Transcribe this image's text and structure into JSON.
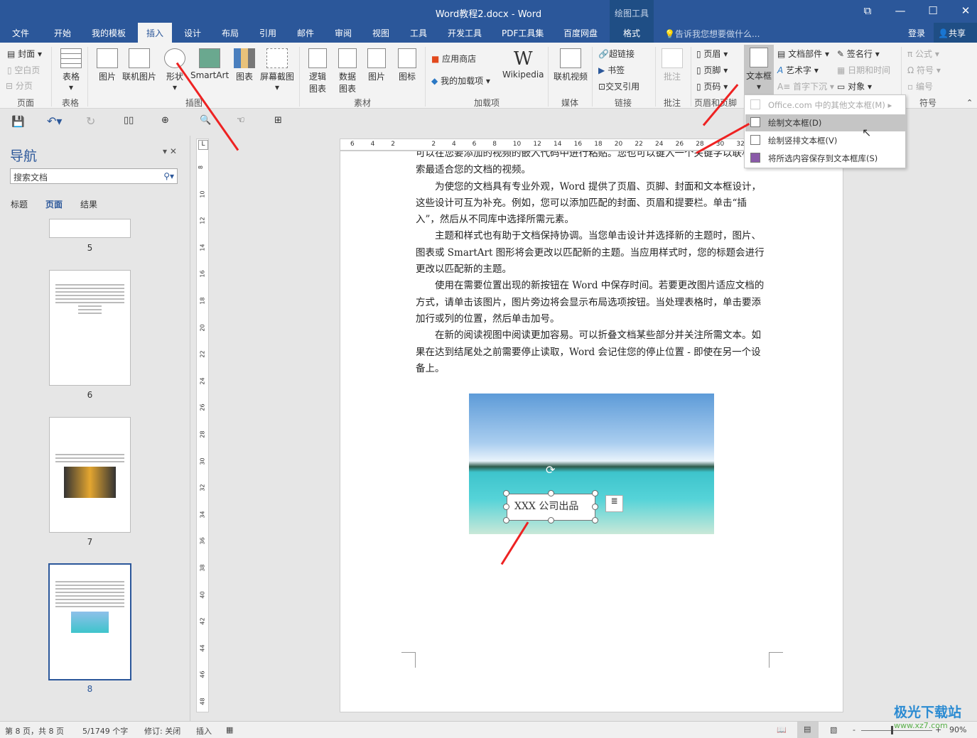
{
  "window": {
    "title": "Word教程2.docx - Word",
    "context_tab_group": "绘图工具",
    "restore_icon": "ribbon-display-icon",
    "minimize": "—",
    "maximize": "☐",
    "close": "✕"
  },
  "tabs": [
    "文件",
    "开始",
    "我的模板",
    "插入",
    "设计",
    "布局",
    "引用",
    "邮件",
    "审阅",
    "视图",
    "工具",
    "开发工具",
    "PDF工具集",
    "百度网盘",
    "格式"
  ],
  "active_tab": "插入",
  "tell_me": "告诉我您想要做什么...",
  "signin": "登录",
  "share": "共享",
  "ribbon": {
    "pages": {
      "items": [
        "封面",
        "空白页",
        "分页"
      ],
      "label": "页面"
    },
    "table": {
      "items": [
        "表格"
      ],
      "label": "表格"
    },
    "illustrations": {
      "items": [
        "图片",
        "联机图片",
        "形状",
        "SmartArt",
        "图表",
        "屏幕截图"
      ],
      "label": "插图"
    },
    "materials": {
      "items": [
        "逻辑图表",
        "数据图表",
        "图片",
        "图标"
      ],
      "label": "素材"
    },
    "addins": {
      "items": [
        "应用商店",
        "我的加载项",
        "Wikipedia"
      ],
      "label": "加载项"
    },
    "media": {
      "items": [
        "联机视频"
      ],
      "label": "媒体"
    },
    "links": {
      "items": [
        "超链接",
        "书签",
        "交叉引用"
      ],
      "label": "链接"
    },
    "comments": {
      "items": [
        "批注"
      ],
      "label": "批注"
    },
    "header_footer": {
      "items": [
        "页眉",
        "页脚",
        "页码"
      ],
      "label": "页眉和页脚"
    },
    "text": {
      "items": [
        "文本框",
        "文档部件",
        "艺术字",
        "首字下沉",
        "签名行",
        "日期和时间",
        "对象"
      ]
    },
    "symbols": {
      "items": [
        "公式",
        "符号",
        "编号"
      ],
      "label": "符号"
    }
  },
  "textbox_menu": [
    "Office.com 中的其他文本框(M)",
    "绘制文本框(D)",
    "绘制竖排文本框(V)",
    "将所选内容保存到文本框库(S)"
  ],
  "nav": {
    "title": "导航",
    "search_placeholder": "搜索文档",
    "tabs": [
      "标题",
      "页面",
      "结果"
    ],
    "active_tab": "页面",
    "pages": [
      "5",
      "6",
      "7",
      "8"
    ],
    "current_page": "8"
  },
  "ruler": {
    "h": [
      "6",
      "4",
      "2",
      "",
      "2",
      "4",
      "6",
      "8",
      "10",
      "12",
      "14",
      "16",
      "18",
      "20",
      "22",
      "24",
      "26",
      "28",
      "30",
      "32"
    ],
    "v": [
      "8",
      "10",
      "12",
      "14",
      "16",
      "18",
      "20",
      "22",
      "24",
      "26",
      "28",
      "30",
      "32",
      "34",
      "36",
      "38",
      "40",
      "42",
      "44",
      "46",
      "48"
    ]
  },
  "document": {
    "paragraphs": [
      "可以在您要添加的视频的嵌入代码中进行粘贴。您也可以键入一个关键字以联机搜索最适合您的文档的视频。",
      "为使您的文档具有专业外观，Word 提供了页眉、页脚、封面和文本框设计，这些设计可互为补充。例如，您可以添加匹配的封面、页眉和提要栏。单击“插入”，然后从不同库中选择所需元素。",
      "主题和样式也有助于文档保持协调。当您单击设计并选择新的主题时，图片、图表或 SmartArt 图形将会更改以匹配新的主题。当应用样式时，您的标题会进行更改以匹配新的主题。",
      "使用在需要位置出现的新按钮在 Word 中保存时间。若要更改图片适应文档的方式，请单击该图片，图片旁边将会显示布局选项按钮。当处理表格时，单击要添加行或列的位置，然后单击加号。",
      "在新的阅读视图中阅读更加容易。可以折叠文档某些部分并关注所需文本。如果在达到结尾处之前需要停止读取，Word 会记住您的停止位置 - 即使在另一个设备上。"
    ],
    "textbox_text": "XXX 公司出品"
  },
  "status": {
    "page": "第 8 页，共 8 页",
    "words": "5/1749 个字",
    "track": "修订: 关闭",
    "mode": "插入",
    "zoom": "90%"
  },
  "watermark": {
    "name": "极光下载站",
    "url": "www.xz7.com"
  }
}
